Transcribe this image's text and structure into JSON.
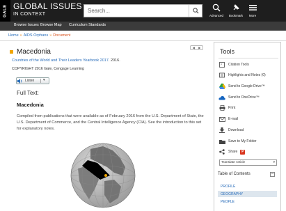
{
  "header": {
    "vendor": "GALE",
    "brand_title": "GLOBAL ISSUES",
    "brand_subtitle": "IN CONTEXT",
    "search_placeholder": "Search...",
    "tools": [
      {
        "label": "Advanced",
        "icon": "search-icon"
      },
      {
        "label": "Bookmark",
        "icon": "bookmark-pin-icon"
      },
      {
        "label": "More",
        "icon": "menu-icon"
      }
    ]
  },
  "subnav": [
    "Browse Issues",
    "Browse Map",
    "Curriculum Standards"
  ],
  "breadcrumb": {
    "home": "Home",
    "parent": "AIDS Orphans",
    "current": "Document"
  },
  "document": {
    "title": "Macedonia",
    "source_link": "Countries of the World and Their Leaders Yearbook 2017",
    "source_year": ". 2016.",
    "copyright": "COPYRIGHT 2016 Gale, Cengage Learning",
    "listen_label": "Listen",
    "fulltext_label": "Full Text:",
    "section_heading": "Macedonia",
    "body": "Compiled from publications that were available as of February 2016 from the U.S. Department of State, the U.S. Department of Commerce, and the Central Intelligence Agency (CIA). See the introduction to this set for explanatory notes."
  },
  "tools_panel": {
    "title": "Tools",
    "items": [
      {
        "label": "Citation Tools",
        "icon": "citation-icon"
      },
      {
        "label": "Highlights and Notes (0)",
        "icon": "highlight-icon"
      },
      {
        "label": "Send to Google Drive™",
        "icon": "google-drive-icon"
      },
      {
        "label": "Send to OneDrive™",
        "icon": "onedrive-icon"
      },
      {
        "label": "Print",
        "icon": "print-icon"
      },
      {
        "label": "E-mail",
        "icon": "email-icon"
      },
      {
        "label": "Download",
        "icon": "download-icon"
      },
      {
        "label": "Save to My Folder",
        "icon": "folder-icon"
      },
      {
        "label": "Share",
        "icon": "share-icon"
      }
    ],
    "translate_label": "Translate Article"
  },
  "toc": {
    "title": "Table of Contents",
    "items": [
      "PROFILE",
      "GEOGRAPHY",
      "PEOPLE"
    ],
    "active_index": 1
  },
  "colors": {
    "header_bg": "#1e1e1e",
    "subnav_bg": "#3b3b3b",
    "link": "#2a6ebb",
    "accent": "#f1a500",
    "breadcrumb_current": "#d9531e"
  }
}
